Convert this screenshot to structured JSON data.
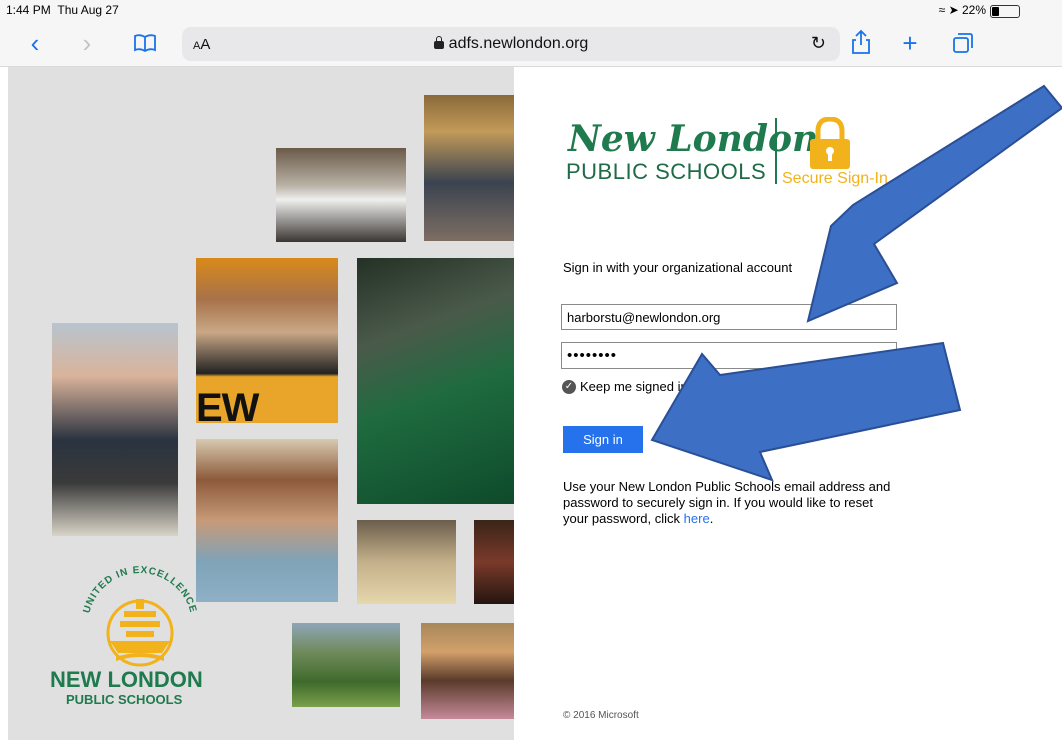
{
  "status": {
    "time": "1:44 PM",
    "date": "Thu Aug 27",
    "battery": "22%"
  },
  "browser": {
    "text_size_label": "AA",
    "url": "adfs.newlondon.org",
    "icons": [
      "back-icon",
      "forward-icon",
      "bookmarks-icon",
      "reload-icon",
      "share-icon",
      "new-tab-icon",
      "tabs-icon"
    ]
  },
  "district_logo": {
    "motto": "UNITED IN EXCELLENCE",
    "name_line1": "NEW LONDON",
    "name_line2": "PUBLIC SCHOOLS"
  },
  "header": {
    "logo_script": "New London",
    "logo_sub": "PUBLIC SCHOOLS",
    "secure_label": "Secure Sign-In"
  },
  "form": {
    "prompt": "Sign in with your organizational account",
    "username": "harborstu@newlondon.org",
    "password_masked": "••••••••",
    "keep_signed_in_label": "Keep me signed in",
    "keep_signed_in_checked": true,
    "sign_in_label": "Sign in"
  },
  "help": {
    "text": "Use your New London Public Schools email address and password to securely sign in. If you would like to reset your password, click ",
    "link": "here",
    "end": "."
  },
  "footer": {
    "copyright": "© 2016 Microsoft"
  },
  "colors": {
    "accent": "#2672ec",
    "brand_green": "#1f7a4d",
    "brand_gold": "#f2b21b",
    "arrow_blue": "#3d6fc4"
  }
}
